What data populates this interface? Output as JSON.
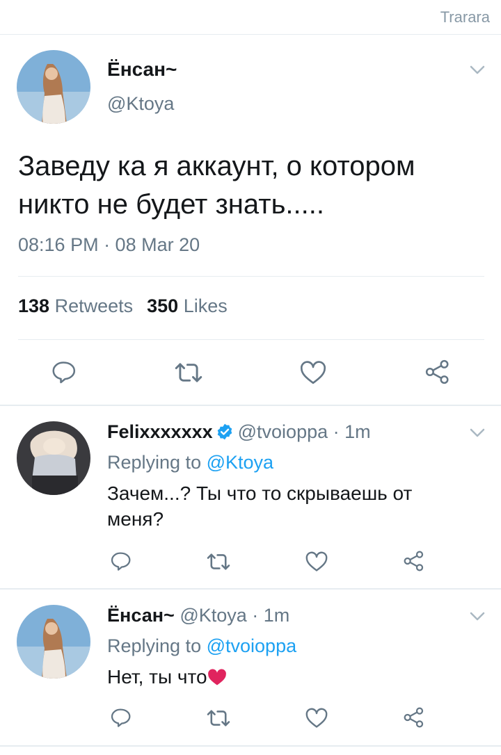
{
  "header": {
    "watermark": "Trarara"
  },
  "main_tweet": {
    "name": "Ёнсан~",
    "handle": "@Ktoya",
    "text": "Заведу ка я аккаунт, о котором никто не будет знать.....",
    "timestamp": "08:16 PM · 08 Mar 20",
    "retweets_count": "138",
    "retweets_label": "Retweets",
    "likes_count": "350",
    "likes_label": "Likes"
  },
  "replies": [
    {
      "name": "Felixxxxxxx",
      "verified": true,
      "handle": "@tvoioppa",
      "time": "· 1m",
      "replying_label": "Replying to",
      "replying_to": "@Ktoya",
      "text": "Зачем...? Ты что то скрываешь от меня?"
    },
    {
      "name": "Ёнсан~",
      "verified": false,
      "handle": "@Ktoya",
      "time": "· 1m",
      "replying_label": "Replying to",
      "replying_to": "@tvoioppa",
      "text": "Нет, ты что"
    }
  ],
  "icons": {
    "reply": "reply-icon",
    "retweet": "retweet-icon",
    "like": "heart-icon",
    "share": "share-icon",
    "menu": "chevron-down-icon",
    "verified": "verified-badge-icon",
    "emoji": "red-heart-emoji"
  },
  "colors": {
    "accent": "#1da1f2",
    "muted": "#657786",
    "text": "#14171a",
    "divider": "#e6ecf0",
    "emoji_heart": "#e0245e"
  }
}
